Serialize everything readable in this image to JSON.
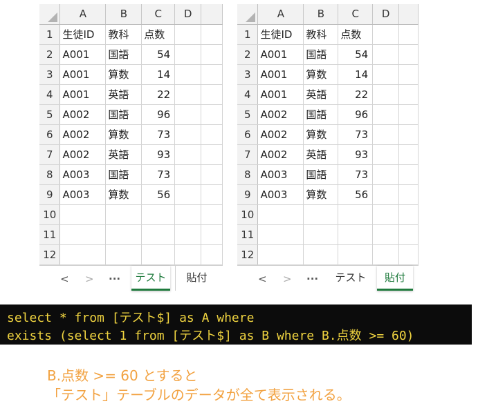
{
  "columns": [
    "A",
    "B",
    "C",
    "D"
  ],
  "row_numbers": [
    "1",
    "2",
    "3",
    "4",
    "5",
    "6",
    "7",
    "8",
    "9",
    "10",
    "11",
    "12"
  ],
  "rows": [
    [
      "生徒ID",
      "教科",
      "点数"
    ],
    [
      "A001",
      "国語",
      "54"
    ],
    [
      "A001",
      "算数",
      "14"
    ],
    [
      "A001",
      "英語",
      "22"
    ],
    [
      "A002",
      "国語",
      "96"
    ],
    [
      "A002",
      "算数",
      "73"
    ],
    [
      "A002",
      "英語",
      "93"
    ],
    [
      "A003",
      "国語",
      "73"
    ],
    [
      "A003",
      "算数",
      "56"
    ]
  ],
  "left_sheet": {
    "nav_prev": "<",
    "nav_next": ">",
    "nav_more": "···",
    "tabs": [
      "テスト",
      "貼付"
    ],
    "active_tab": "テスト"
  },
  "right_sheet": {
    "nav_prev": "<",
    "nav_next": ">",
    "nav_more": "···",
    "tabs": [
      "テスト",
      "貼付"
    ],
    "active_tab": "貼付"
  },
  "sql": {
    "line1": "select * from [テスト$] as A where",
    "line2": "exists (select 1 from [テスト$] as B where B.点数 >= 60)"
  },
  "note": {
    "line1": "B.点数 >= 60 とすると",
    "line2": "「テスト」テーブルのデータが全て表示される。"
  },
  "colors": {
    "sql_background": "#0c0c0c",
    "sql_text": "#f0d440",
    "note_text": "#f2a241",
    "active_tab": "#1e7a3c"
  }
}
